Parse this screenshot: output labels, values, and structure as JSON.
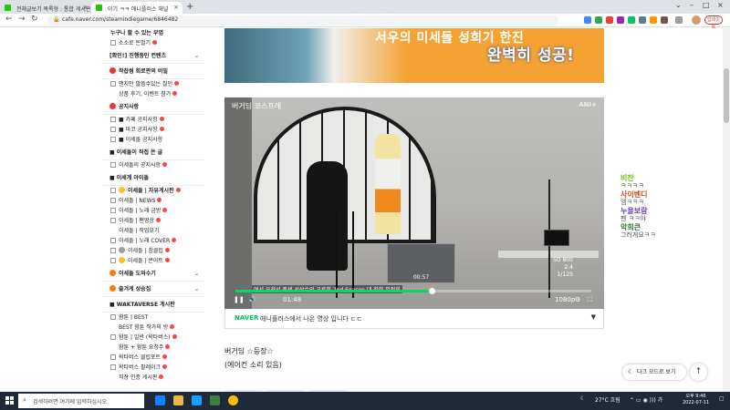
{
  "browser": {
    "tabs": [
      {
        "label": "전체글보기 목록형 : 통합 게시판"
      },
      {
        "label": "이기 ㅋㅋ 애니플러스 채널"
      }
    ],
    "url": "cafe.naver.com/steamindiegame/6846482",
    "update_label": "업데이트"
  },
  "sidebar": {
    "rows": [
      {
        "type": "item",
        "label": "누구나 할 수 있는 부엽",
        "bold": true
      },
      {
        "type": "item",
        "label": "소소로 돈벌기",
        "badge": true,
        "box": true
      },
      {
        "type": "head",
        "label": "[확인!] 진행중인 컨텐츠",
        "chev": "⌄"
      },
      {
        "type": "head",
        "label": "착잡썸 회로판의 비밀",
        "icon": "pin"
      },
      {
        "type": "item",
        "label": "맨지만 말씀수있는 칠인",
        "badge": true,
        "box": true
      },
      {
        "type": "item",
        "label": "상품 후기, 이벤트 참가",
        "badge": true,
        "indent": true
      },
      {
        "type": "head",
        "label": "공지사항",
        "icon": "gear"
      },
      {
        "type": "item",
        "label": "■ 카페 공지사항",
        "badge": true,
        "box": true
      },
      {
        "type": "item",
        "label": "■ 마코 공지사항",
        "badge": true,
        "box": true
      },
      {
        "type": "item",
        "label": "■ 이세돌 공지사항",
        "box": true
      },
      {
        "type": "head",
        "label": "■ 이세돌이 직접 쓴 글"
      },
      {
        "type": "item",
        "label": "이세돌의 공지사항",
        "badge": true,
        "box": true
      },
      {
        "type": "head",
        "label": "■ 이세계 아이돌"
      },
      {
        "type": "item",
        "label": "이세돌 | 자유게시판",
        "badge": true,
        "box": true,
        "bold": true,
        "icon": "yellow"
      },
      {
        "type": "item",
        "label": "이세돌 | NEWS",
        "badge": true,
        "box": true
      },
      {
        "type": "item",
        "label": "이세돌 | 노래 금방",
        "badge": true,
        "box": true
      },
      {
        "type": "item",
        "label": "이세돌 | 팬영상",
        "badge": true,
        "box": true
      },
      {
        "type": "item",
        "label": "이세돌 | 작업요기",
        "indent": true
      },
      {
        "type": "item",
        "label": "이세돌 | 노래 COVER",
        "badge": true,
        "box": true
      },
      {
        "type": "item",
        "label": "이세돌 | 창클럽",
        "badge": true,
        "box": true,
        "icon": "grey"
      },
      {
        "type": "item",
        "label": "이세돌 | 콘아트",
        "badge": true,
        "box": true,
        "icon": "yellow"
      },
      {
        "type": "head",
        "label": "이세돌 도와수기",
        "chev": "⌄",
        "icon": "orange"
      },
      {
        "type": "head",
        "label": "즐겨게 성숭집",
        "chev": "⌄",
        "icon": "orange"
      },
      {
        "type": "head",
        "label": "■ WAKTAVERSE 게시판"
      },
      {
        "type": "item",
        "label": "왐툰 | BEST",
        "box": true
      },
      {
        "type": "item",
        "label": "BEST 왐툰 작가의 방",
        "badge": true,
        "indent": true
      },
      {
        "type": "item",
        "label": "왐툰 | 일반 (왁타버스)",
        "badge": true,
        "box": true
      },
      {
        "type": "item",
        "label": "왐툰 + 왐툰 요청주",
        "badge": true,
        "indent": true
      },
      {
        "type": "item",
        "label": "왁타버스 클립포트",
        "badge": true,
        "box": true
      },
      {
        "type": "item",
        "label": "왁타버스 팔레이크",
        "badge": true,
        "box": true
      },
      {
        "type": "item",
        "label": "직장 인증 게시판",
        "badge": true,
        "indent": true
      }
    ]
  },
  "banner": {
    "line1": "서우의 미세돌 성희기 한진",
    "line2": "완벽히 성공!"
  },
  "video": {
    "channel_label": "버거딤 코스프레",
    "watermark": "ANI+",
    "thumb_time": "00:57",
    "subtitle": "여서 오래서 출세 서상수의 교류회 2nd Season 대 참한 밀접회",
    "time": "01:48",
    "quality": "1080p",
    "hud_lines": [
      "SO 800",
      "2.4",
      "1/125"
    ],
    "progress": 0.55
  },
  "caption": {
    "brand": "NAVER",
    "text": "애니플러스에서 나온 영상 입니다 ㄷㄷ"
  },
  "post": {
    "line1": "버거딤 ☆등장☆",
    "line2": "(에어컨 소리 있음)"
  },
  "chat": [
    {
      "name": "비찬",
      "msg": "ㅋㅋㅋㅋ",
      "color": "#7fb800"
    },
    {
      "name": "사이벤디",
      "msg": "엠ㅋㅋㅋ",
      "color": "#d44a1f"
    },
    {
      "name": "누을보람",
      "msg": "팬 ㅋㅋ야",
      "color": "#6a3fb5"
    },
    {
      "name": "악희큰",
      "msg": "그러게요ㅋㅋ",
      "color": "#2e7d32"
    }
  ],
  "floating": {
    "darkmode_label": "다크 모드로 보기",
    "top_label": "↑"
  },
  "taskbar": {
    "search_placeholder": "검색하려면 여기에 입력하십시오.",
    "temp": "27°C 흐림",
    "time": "오후 9:46",
    "date": "2022-07-11"
  }
}
